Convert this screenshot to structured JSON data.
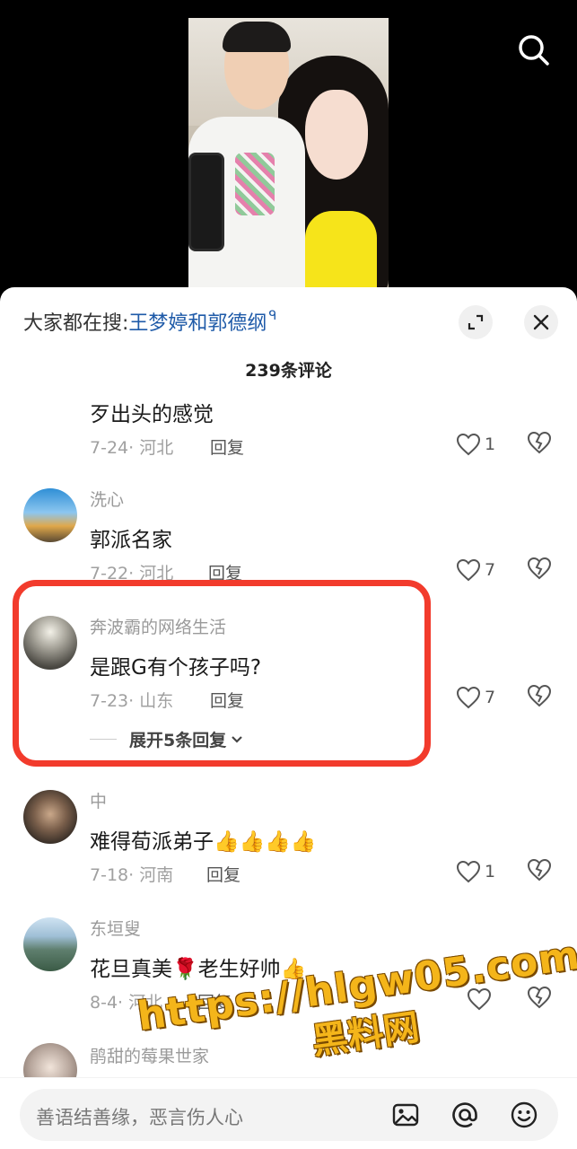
{
  "header": {
    "hot_search_prefix": "大家都在搜:",
    "hot_search_keyword": "王梦婷和郭德纲",
    "hot_search_mark": "ᑫ",
    "comment_count": "239条评论"
  },
  "comments": [
    {
      "user": "",
      "text": "歹出头的感觉",
      "date": "7-24",
      "location": "河北",
      "reply_label": "回复",
      "likes": "1"
    },
    {
      "user": "洗心",
      "text": "郭派名家",
      "date": "7-22",
      "location": "河北",
      "reply_label": "回复",
      "likes": "7"
    },
    {
      "user": "奔波霸的网络生活",
      "text": "是跟G有个孩子吗?",
      "date": "7-23",
      "location": "山东",
      "reply_label": "回复",
      "likes": "7",
      "expand_label": "展开5条回复"
    },
    {
      "user": "中",
      "text": "难得荀派弟子",
      "emoji": "👍👍👍👍",
      "date": "7-18",
      "location": "河南",
      "reply_label": "回复",
      "likes": "1"
    },
    {
      "user": "东垣叟",
      "text": "花旦真美",
      "text_rose": "🌹",
      "text_tail": "老生好帅",
      "emoji": "👍",
      "date": "8-4",
      "location": "河北",
      "reply_label": "回复",
      "likes": ""
    },
    {
      "user": "鹃甜的莓果世家"
    }
  ],
  "input": {
    "placeholder": "善语结善缘，恶言伤人心"
  },
  "watermark": {
    "url": "https://hlgw05.com",
    "sub": "黑料网"
  },
  "colors": {
    "accent_link": "#1e5aa8",
    "highlight_border": "#f23b2c",
    "watermark": "#f4b51a"
  },
  "icons": [
    "search-icon",
    "expand-icon",
    "close-icon",
    "heart-icon",
    "broken-heart-icon",
    "image-icon",
    "at-icon",
    "emoji-icon"
  ]
}
